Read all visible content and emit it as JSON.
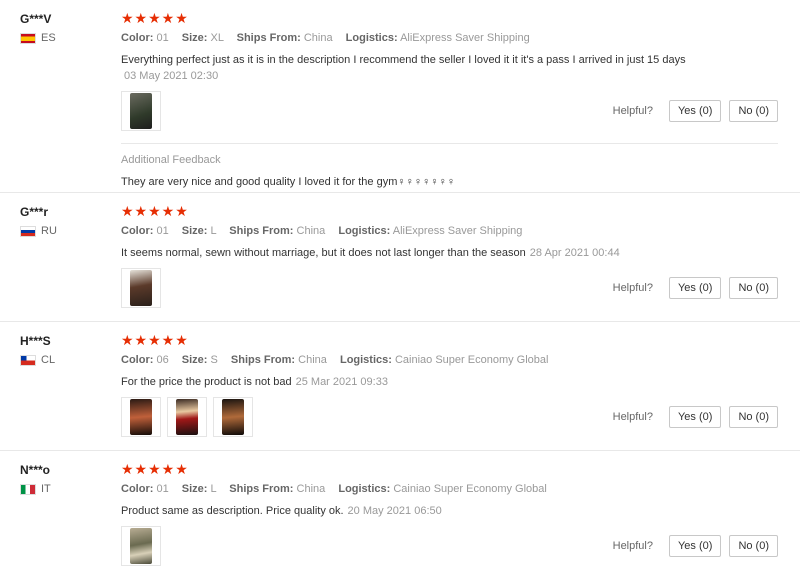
{
  "labels": {
    "color": "Color:",
    "size": "Size:",
    "ships_from": "Ships From:",
    "logistics": "Logistics:",
    "helpful": "Helpful?",
    "additional_feedback": "Additional Feedback"
  },
  "colors": {
    "star": "#e62e04",
    "muted": "#999999"
  },
  "reviews": [
    {
      "user": "G***V",
      "country": "ES",
      "stars": "★★★★★",
      "color": "01",
      "size": "XL",
      "ships_from": "China",
      "logistics": "AliExpress Saver Shipping",
      "text": "Everything perfect just as it is in the description I recommend the seller I loved it it it's a pass I arrived in just 15 days",
      "date": "03 May 2021 02:30",
      "yes": "Yes (0)",
      "no": "No (0)",
      "additional_feedback": "They are very nice and good quality I loved it for the gym♀♀♀♀♀♀♀"
    },
    {
      "user": "G***r",
      "country": "RU",
      "stars": "★★★★★",
      "color": "01",
      "size": "L",
      "ships_from": "China",
      "logistics": "AliExpress Saver Shipping",
      "text": "It seems normal, sewn without marriage, but it does not last longer than the season",
      "date": "28 Apr 2021 00:44",
      "yes": "Yes (0)",
      "no": "No (0)"
    },
    {
      "user": "H***S",
      "country": "CL",
      "stars": "★★★★★",
      "color": "06",
      "size": "S",
      "ships_from": "China",
      "logistics": "Cainiao Super Economy Global",
      "text": "For the price the product is not bad",
      "date": "25 Mar 2021 09:33",
      "yes": "Yes (0)",
      "no": "No (0)"
    },
    {
      "user": "N***o",
      "country": "IT",
      "stars": "★★★★★",
      "color": "01",
      "size": "L",
      "ships_from": "China",
      "logistics": "Cainiao Super Economy Global",
      "text": "Product same as description. Price quality ok.",
      "date": "20 May 2021 06:50",
      "yes": "Yes (0)",
      "no": "No (0)"
    }
  ]
}
